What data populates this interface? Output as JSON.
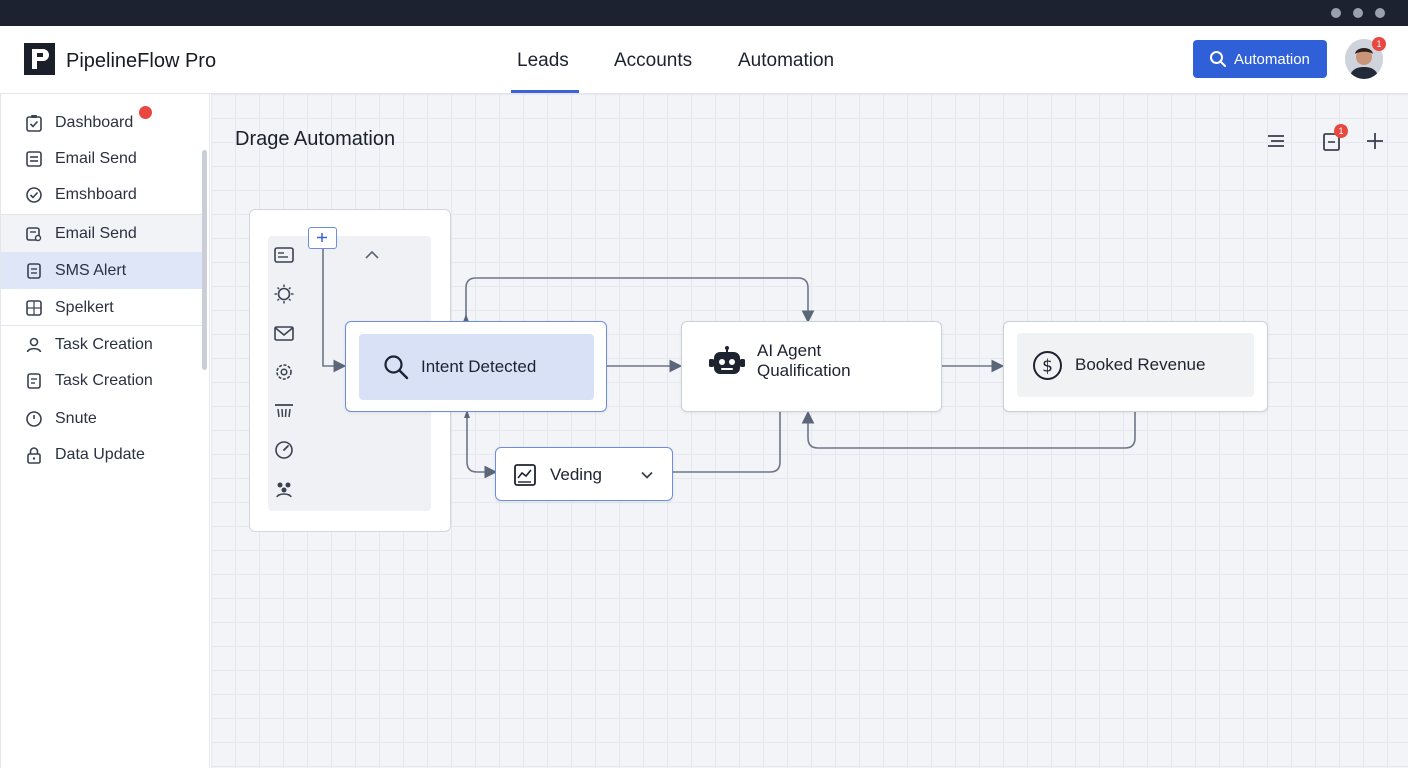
{
  "app": {
    "title": "PipelineFlow Pro"
  },
  "nav": {
    "tabs": [
      {
        "label": "Leads",
        "active": true
      },
      {
        "label": "Accounts",
        "active": false
      },
      {
        "label": "Automation",
        "active": false
      }
    ]
  },
  "header": {
    "action_button": "Automation",
    "avatar_badge": "1"
  },
  "sidebar": {
    "items": [
      {
        "label": "Dashboard",
        "icon": "clipboard-check-icon",
        "notification": true
      },
      {
        "label": "Email Send",
        "icon": "list-icon"
      },
      {
        "label": "Emshboard",
        "icon": "check-circle-icon"
      },
      {
        "label": "Email Send",
        "icon": "mail-search-icon",
        "state": "hover"
      },
      {
        "label": "SMS Alert",
        "icon": "document-icon",
        "state": "active"
      },
      {
        "label": "Spelkert",
        "icon": "spreadsheet-icon"
      },
      {
        "label": "Task Creation",
        "icon": "user-icon"
      },
      {
        "label": "Task Creation",
        "icon": "document-icon"
      },
      {
        "label": "Snute",
        "icon": "timer-icon"
      },
      {
        "label": "Data Update",
        "icon": "lock-icon"
      }
    ]
  },
  "canvas": {
    "title": "Drage Automation",
    "toolbar_badge": "1",
    "tools": [
      "filter-list-icon",
      "document-icon",
      "plus-icon"
    ]
  },
  "palette": {
    "icons": [
      "card-icon",
      "sun-icon",
      "mail-icon",
      "settings-icon",
      "funnel-icon",
      "gauge-icon",
      "people-icon"
    ]
  },
  "flow": {
    "nodes": [
      {
        "id": "intent",
        "label": "Intent Detected",
        "icon": "search-icon"
      },
      {
        "id": "agent",
        "label_line1": "AI Agent",
        "label_line2": "Qualification",
        "icon": "robot-icon"
      },
      {
        "id": "revenue",
        "label": "Booked Revenue",
        "icon": "dollar-icon"
      },
      {
        "id": "veding",
        "label": "Veding",
        "icon": "chart-icon"
      }
    ]
  },
  "colors": {
    "accent": "#3060d8",
    "active_bg": "#dfe6f7",
    "badge": "#e8483f",
    "chrome": "#1c2230"
  }
}
